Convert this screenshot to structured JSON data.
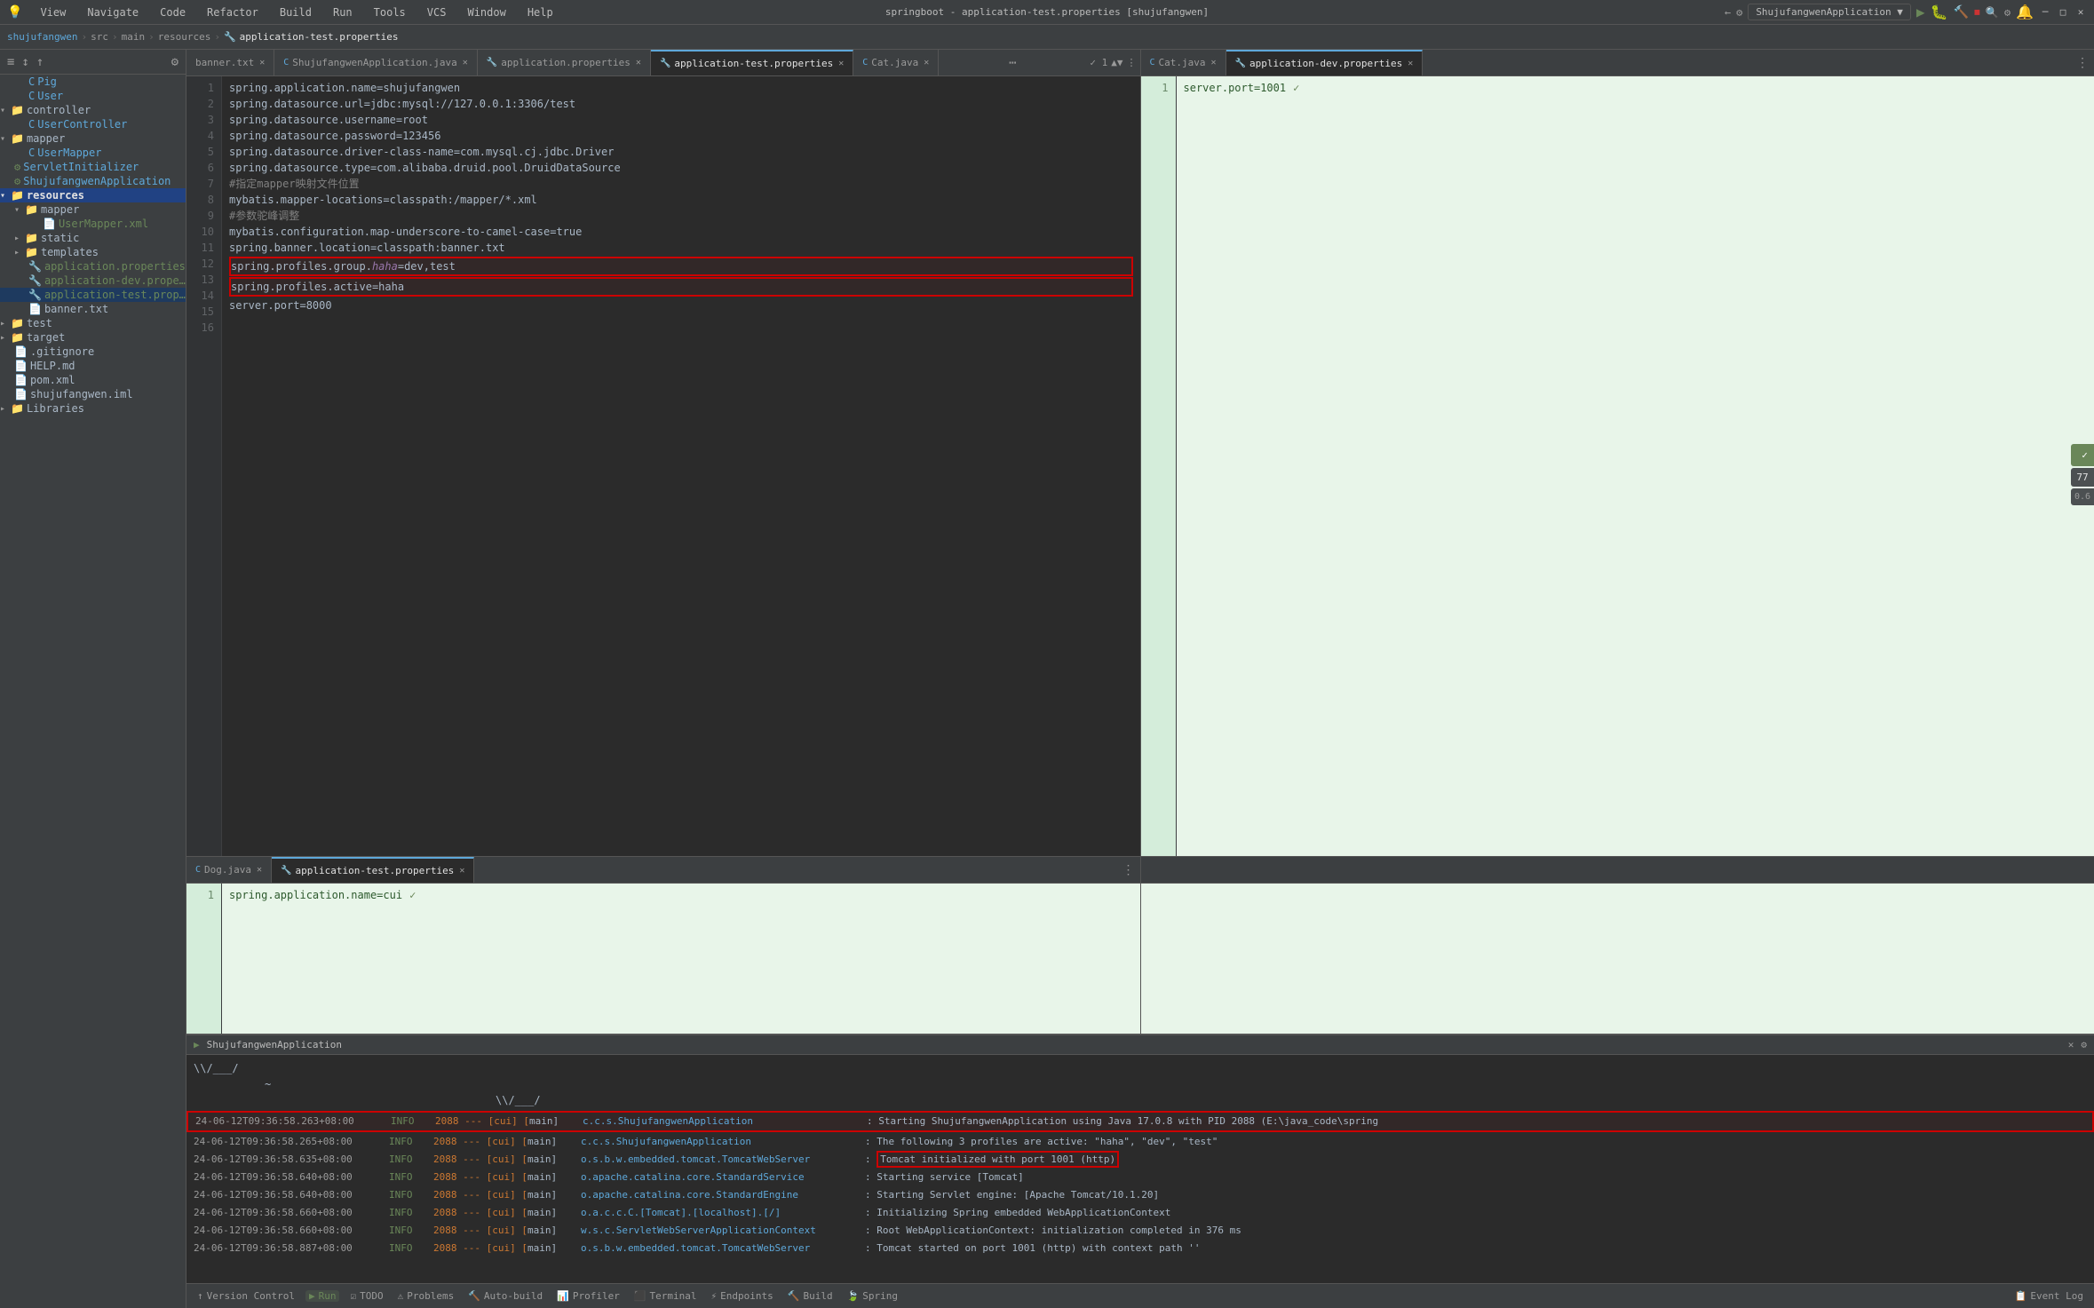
{
  "window": {
    "title": "springboot - application-test.properties [shujufangwen]",
    "minimize": "─",
    "restore": "□",
    "close": "✕"
  },
  "menu": {
    "items": [
      "View",
      "Navigate",
      "Code",
      "Refactor",
      "Build",
      "Run",
      "Tools",
      "VCS",
      "Window",
      "Help"
    ]
  },
  "breadcrumb": {
    "parts": [
      "shujufangwen",
      "src",
      "main",
      "resources",
      "application-test.properties"
    ]
  },
  "sidebar": {
    "toolbar_icons": [
      "≡",
      "↕",
      "↑",
      "⚙"
    ],
    "tree": [
      {
        "indent": 1,
        "type": "file",
        "icon": "🐷",
        "label": "Pig",
        "color": "blue"
      },
      {
        "indent": 1,
        "type": "file",
        "icon": "👤",
        "label": "User",
        "color": "blue"
      },
      {
        "indent": 0,
        "type": "folder",
        "icon": "📁",
        "label": "controller",
        "color": "folder",
        "open": true
      },
      {
        "indent": 1,
        "type": "file",
        "icon": "📄",
        "label": "UserController",
        "color": "blue"
      },
      {
        "indent": 0,
        "type": "folder",
        "icon": "📁",
        "label": "mapper",
        "color": "folder",
        "open": true
      },
      {
        "indent": 1,
        "type": "file",
        "icon": "📄",
        "label": "UserMapper",
        "color": "blue"
      },
      {
        "indent": 0,
        "type": "file",
        "icon": "🔧",
        "label": "ServletInitializer",
        "color": "blue"
      },
      {
        "indent": 0,
        "type": "file",
        "icon": "🔧",
        "label": "ShujufangwenApplication",
        "color": "blue"
      },
      {
        "indent": 0,
        "type": "folder",
        "icon": "📁",
        "label": "resources",
        "color": "bold",
        "open": true,
        "selected": true
      },
      {
        "indent": 1,
        "type": "folder",
        "icon": "📁",
        "label": "mapper",
        "color": "folder",
        "open": true
      },
      {
        "indent": 2,
        "type": "file",
        "icon": "📄",
        "label": "UserMapper.xml",
        "color": "green"
      },
      {
        "indent": 1,
        "type": "folder",
        "icon": "📁",
        "label": "static",
        "color": "folder"
      },
      {
        "indent": 1,
        "type": "folder",
        "icon": "📁",
        "label": "templates",
        "color": "folder"
      },
      {
        "indent": 1,
        "type": "file",
        "icon": "🔧",
        "label": "application.properties",
        "color": "green"
      },
      {
        "indent": 1,
        "type": "file",
        "icon": "🔧",
        "label": "application-dev.properties",
        "color": "green"
      },
      {
        "indent": 1,
        "type": "file",
        "icon": "🔧",
        "label": "application-test.properties",
        "color": "green",
        "selected": true
      },
      {
        "indent": 1,
        "type": "file",
        "icon": "📄",
        "label": "banner.txt",
        "color": "normal"
      },
      {
        "indent": 0,
        "type": "folder",
        "icon": "📁",
        "label": "test",
        "color": "folder"
      },
      {
        "indent": 0,
        "type": "folder",
        "icon": "📁",
        "label": "target",
        "color": "folder"
      },
      {
        "indent": 0,
        "type": "file",
        "icon": "📄",
        "label": ".gitignore",
        "color": "normal"
      },
      {
        "indent": 0,
        "type": "file",
        "icon": "📄",
        "label": "HELP.md",
        "color": "normal"
      },
      {
        "indent": 0,
        "type": "file",
        "icon": "📄",
        "label": "pom.xml",
        "color": "normal"
      },
      {
        "indent": 0,
        "type": "file",
        "icon": "📄",
        "label": "shujufangwen.iml",
        "color": "normal"
      },
      {
        "indent": 0,
        "type": "folder",
        "icon": "📁",
        "label": "Libraries",
        "color": "folder"
      }
    ]
  },
  "left_tabs": [
    {
      "label": "banner.txt",
      "active": false,
      "closable": true
    },
    {
      "label": "ShujufangwenApplication.java",
      "active": false,
      "closable": true
    },
    {
      "label": "application.properties",
      "active": false,
      "closable": true
    },
    {
      "label": "Cat.java",
      "active": false,
      "closable": true
    }
  ],
  "right_tabs": [
    {
      "label": "Cat.java",
      "active": false,
      "closable": true
    },
    {
      "label": "application-dev.properties",
      "active": true,
      "closable": true
    }
  ],
  "left_editor": {
    "filename": "application-test.properties",
    "lines": [
      {
        "num": 1,
        "text": "spring.application.name=shujufangwen",
        "type": "normal"
      },
      {
        "num": 2,
        "text": "spring.datasource.url=jdbc:mysql://127.0.0.1:3306/test",
        "type": "normal"
      },
      {
        "num": 3,
        "text": "spring.datasource.username=root",
        "type": "normal"
      },
      {
        "num": 4,
        "text": "spring.datasource.password=123456",
        "type": "normal"
      },
      {
        "num": 5,
        "text": "spring.datasource.driver-class-name=com.mysql.cj.jdbc.Driver",
        "type": "normal"
      },
      {
        "num": 6,
        "text": "spring.datasource.type=com.alibaba.druid.pool.DruidDataSource",
        "type": "normal"
      },
      {
        "num": 7,
        "text": "#指定mapper映射文件位置",
        "type": "comment"
      },
      {
        "num": 8,
        "text": "mybatis.mapper-locations=classpath:/mapper/*.xml",
        "type": "normal"
      },
      {
        "num": 9,
        "text": "#参数驼峰调整",
        "type": "comment"
      },
      {
        "num": 10,
        "text": "mybatis.configuration.map-underscore-to-camel-case=true",
        "type": "normal"
      },
      {
        "num": 11,
        "text": "spring.banner.location=classpath:banner.txt",
        "type": "normal"
      },
      {
        "num": 12,
        "text": "spring.profiles.group.haha=dev,test",
        "type": "highlighted"
      },
      {
        "num": 13,
        "text": "spring.profiles.active=haha",
        "type": "highlighted"
      },
      {
        "num": 14,
        "text": "server.port=8000",
        "type": "normal"
      },
      {
        "num": 15,
        "text": "",
        "type": "normal"
      },
      {
        "num": 16,
        "text": "",
        "type": "normal"
      }
    ]
  },
  "right_editor": {
    "filename": "application-dev.properties",
    "lines": [
      {
        "num": 1,
        "text": "server.port=1001",
        "type": "normal"
      }
    ]
  },
  "bottom_left_tabs": [
    {
      "label": "Dog.java",
      "active": false,
      "closable": true
    },
    {
      "label": "application-test.properties",
      "active": true,
      "closable": true
    }
  ],
  "bottom_editor": {
    "lines": [
      {
        "num": 1,
        "text": "spring.application.name=cui",
        "type": "normal"
      }
    ]
  },
  "run_panel": {
    "title": "ShujufangwenApplication",
    "ascii_lines": [
      "  \\/___/",
      "~",
      "  \\/___/"
    ],
    "log_lines": [
      {
        "time": "24-06-12T09:36:58.263+08:00",
        "level": "INFO",
        "pid": "2088",
        "thread": "---",
        "cui": "[cui] [",
        "logger_thread": "main]",
        "class": "c.c.s.ShujufangwenApplication",
        "msg": ": Starting ShujufangwenApplication using Java 17.0.8 with PID 2088 (E:\\java_code\\spring",
        "highlight": false,
        "red_box": true
      },
      {
        "time": "24-06-12T09:36:58.265+08:00",
        "level": "INFO",
        "pid": "2088",
        "thread": "---",
        "cui": "[cui] [",
        "logger_thread": "main]",
        "class": "c.c.s.ShujufangwenApplication",
        "msg": ": The following 3 profiles are active: \"haha\", \"dev\", \"test\"",
        "highlight": false
      },
      {
        "time": "24-06-12T09:36:58.635+08:00",
        "level": "INFO",
        "pid": "2088",
        "thread": "---",
        "cui": "[cui] [",
        "logger_thread": "main]",
        "class": "o.s.b.w.embedded.tomcat.TomcatWebServer",
        "msg": ": Tomcat initialized with port 1001 (http)",
        "highlight": true,
        "red_box_msg": true
      },
      {
        "time": "24-06-12T09:36:58.640+08:00",
        "level": "INFO",
        "pid": "2088",
        "thread": "---",
        "cui": "[cui] [",
        "logger_thread": "main]",
        "class": "o.apache.catalina.core.StandardService",
        "msg": ": Starting service [Tomcat]",
        "highlight": false
      },
      {
        "time": "24-06-12T09:36:58.640+08:00",
        "level": "INFO",
        "pid": "2088",
        "thread": "---",
        "cui": "[cui] [",
        "logger_thread": "main]",
        "class": "o.apache.catalina.core.StandardEngine",
        "msg": ": Starting Servlet engine: [Apache Tomcat/10.1.20]",
        "highlight": false
      },
      {
        "time": "24-06-12T09:36:58.660+08:00",
        "level": "INFO",
        "pid": "2088",
        "thread": "---",
        "cui": "[cui] [",
        "logger_thread": "main]",
        "class": "o.a.c.c.C.[Tomcat].[localhost].[/]",
        "msg": ": Initializing Spring embedded WebApplicationContext",
        "highlight": false
      },
      {
        "time": "24-06-12T09:36:58.660+08:00",
        "level": "INFO",
        "pid": "2088",
        "thread": "---",
        "cui": "[cui] [",
        "logger_thread": "main]",
        "class": "w.s.c.ServletWebServerApplicationContext",
        "msg": ": Root WebApplicationContext: initialization completed in 376 ms",
        "highlight": false
      },
      {
        "time": "24-06-12T09:36:58.887+08:00",
        "level": "INFO",
        "pid": "2088",
        "thread": "---",
        "cui": "[cui] [",
        "logger_thread": "main]",
        "class": "o.s.b.w.embedded.tomcat.TomcatWebServer",
        "msg": ": Tomcat started on port 1001 (http) with context path ''",
        "highlight": false
      }
    ]
  },
  "bottom_status": {
    "items": [
      {
        "label": "Version Control",
        "icon": "↑",
        "active": false
      },
      {
        "label": "Run",
        "icon": "▶",
        "active": true
      },
      {
        "label": "TODO",
        "icon": "☑",
        "active": false
      },
      {
        "label": "Problems",
        "icon": "⚠",
        "active": false
      },
      {
        "label": "Auto-build",
        "icon": "🔨",
        "active": false
      },
      {
        "label": "Profiler",
        "icon": "📊",
        "active": false
      },
      {
        "label": "Terminal",
        "icon": "⬛",
        "active": false
      },
      {
        "label": "Endpoints",
        "icon": "⚡",
        "active": false
      },
      {
        "label": "Build",
        "icon": "🔨",
        "active": false
      },
      {
        "label": "Spring",
        "icon": "🍃",
        "active": false
      }
    ],
    "right_items": [
      {
        "label": "Event Log",
        "icon": "📋"
      }
    ]
  },
  "right_panel_notif": {
    "badge_77": "77",
    "badge_06": "0.6"
  }
}
